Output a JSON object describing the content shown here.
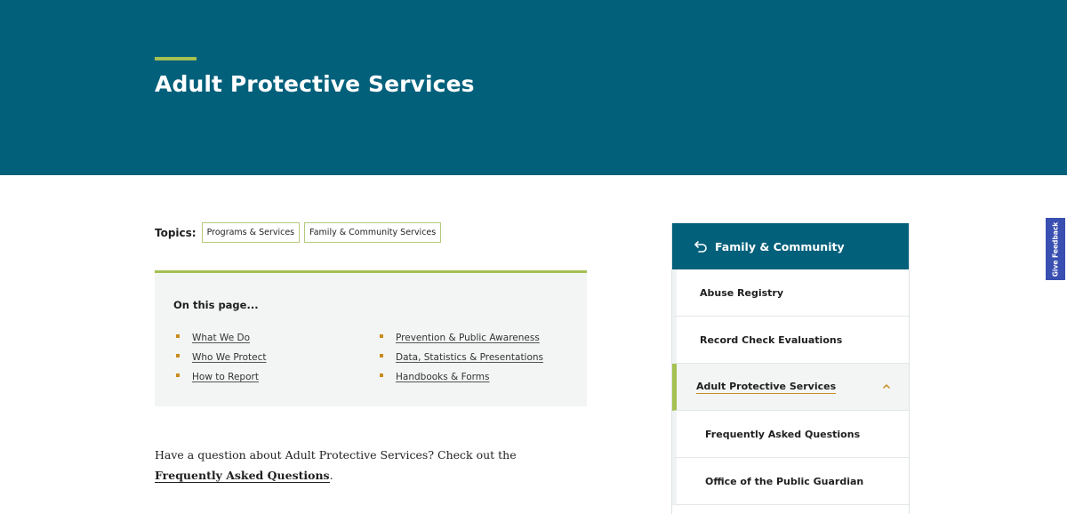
{
  "hero": {
    "title": "Adult Protective Services"
  },
  "topics": {
    "label": "Topics:",
    "tags": [
      "Programs & Services",
      "Family & Community Services"
    ]
  },
  "on_this_page": {
    "heading": "On this page...",
    "left_links": [
      "What We Do",
      "Who We Protect",
      "How to Report"
    ],
    "right_links": [
      "Prevention & Public Awareness",
      "Data, Statistics & Presentations",
      "Handbooks & Forms"
    ]
  },
  "question": {
    "prefix": "Have a question about Adult Protective Services? Check out the ",
    "link": "Frequently Asked Questions",
    "suffix": "."
  },
  "sidenav": {
    "header": "Family & Community",
    "items": [
      {
        "label": "Abuse Registry"
      },
      {
        "label": "Record Check Evaluations"
      },
      {
        "label": "Adult Protective Services"
      },
      {
        "label": "Frequently Asked Questions"
      },
      {
        "label": "Office of the Public Guardian"
      }
    ]
  },
  "feedback": {
    "label": "Give Feedback"
  },
  "colors": {
    "brand": "#03607b",
    "accent": "#a4c152",
    "bullet": "#c88c1e",
    "feedback": "#3a4fb2"
  }
}
